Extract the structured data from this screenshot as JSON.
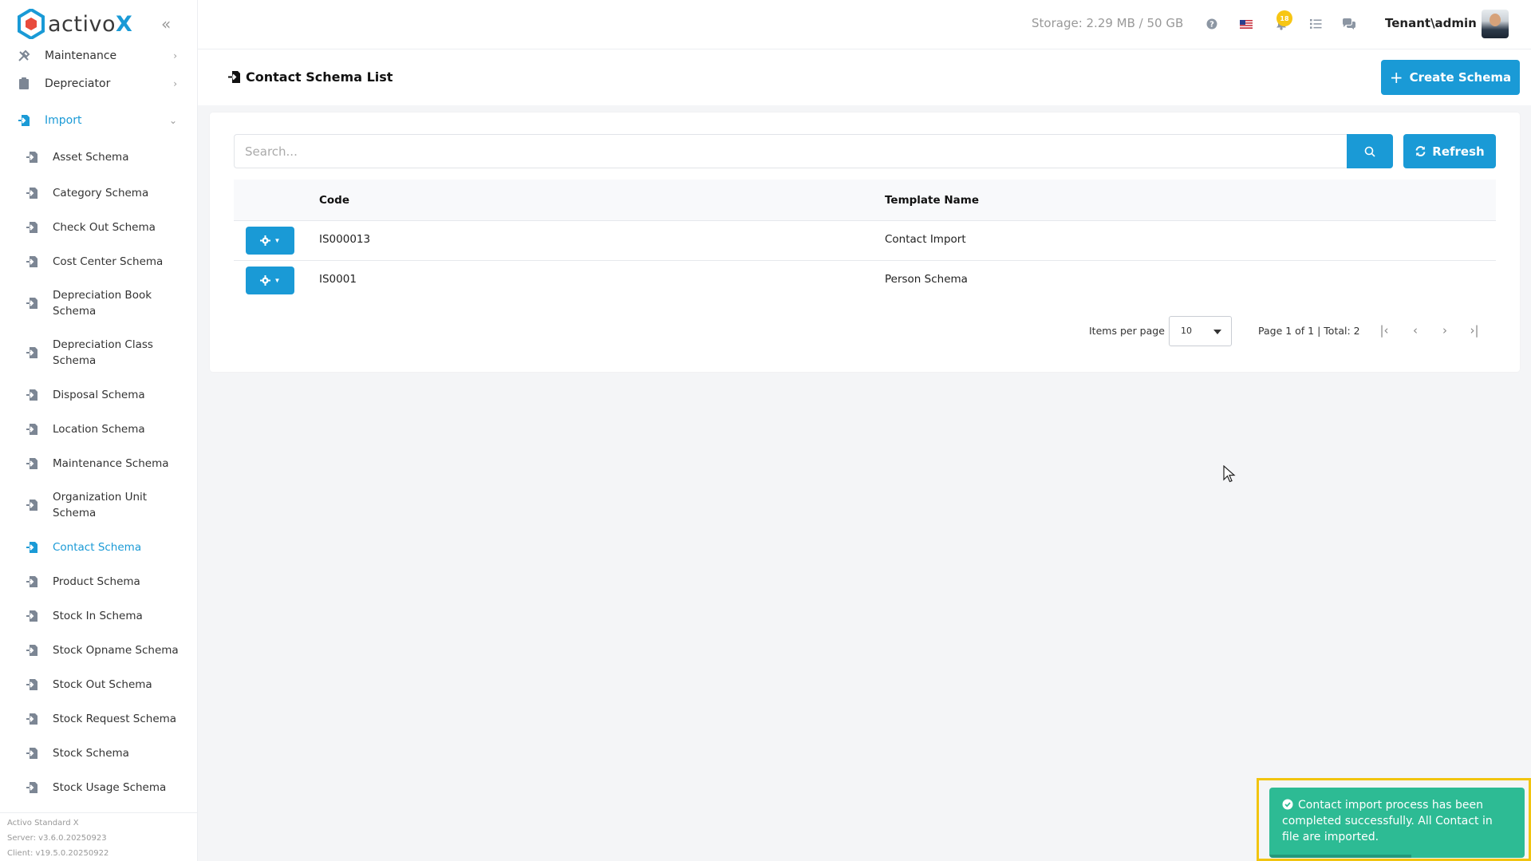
{
  "brand": {
    "name_prefix": "activo",
    "name_suffix": "X"
  },
  "sidebar": {
    "top_items": [
      {
        "label": "Maintenance",
        "icon": "wrench-icon"
      },
      {
        "label": "Depreciator",
        "icon": "clipboard-icon"
      },
      {
        "label": "Import",
        "icon": "import-icon",
        "expanded": true
      }
    ],
    "import_items": [
      {
        "label": "Asset Schema"
      },
      {
        "label": "Category Schema"
      },
      {
        "label": "Check Out Schema"
      },
      {
        "label": "Cost Center Schema"
      },
      {
        "label": "Depreciation Book Schema"
      },
      {
        "label": "Depreciation Class Schema"
      },
      {
        "label": "Disposal Schema"
      },
      {
        "label": "Location Schema"
      },
      {
        "label": "Maintenance Schema"
      },
      {
        "label": "Organization Unit Schema"
      },
      {
        "label": "Contact Schema",
        "active": true
      },
      {
        "label": "Product Schema"
      },
      {
        "label": "Stock In Schema"
      },
      {
        "label": "Stock Opname Schema"
      },
      {
        "label": "Stock Out Schema"
      },
      {
        "label": "Stock Request Schema"
      },
      {
        "label": "Stock Schema"
      },
      {
        "label": "Stock Usage Schema"
      }
    ],
    "footer": {
      "product": "Activo Standard X",
      "server": "Server: v3.6.0.20250923",
      "client": "Client: v19.5.0.20250922"
    }
  },
  "header": {
    "storage": "Storage: 2.29 MB / 50 GB",
    "notification_count": "18",
    "user": "Tenant\\admin"
  },
  "page": {
    "title": "Contact Schema List",
    "create_label": "Create Schema"
  },
  "search": {
    "placeholder": "Search...",
    "refresh_label": "Refresh"
  },
  "table": {
    "columns": {
      "code": "Code",
      "template_name": "Template Name"
    },
    "rows": [
      {
        "code": "IS000013",
        "template_name": "Contact Import"
      },
      {
        "code": "IS0001",
        "template_name": "Person Schema"
      }
    ]
  },
  "pagination": {
    "items_per_page_label": "Items per page",
    "items_per_page": "10",
    "info": "Page 1 of 1 | Total: 2"
  },
  "toast": {
    "message": "Contact import process has been completed successfully. All Contact in file are imported."
  },
  "colors": {
    "accent": "#1a9ad6",
    "success": "#2dbb94",
    "highlight": "#f1c40f"
  }
}
